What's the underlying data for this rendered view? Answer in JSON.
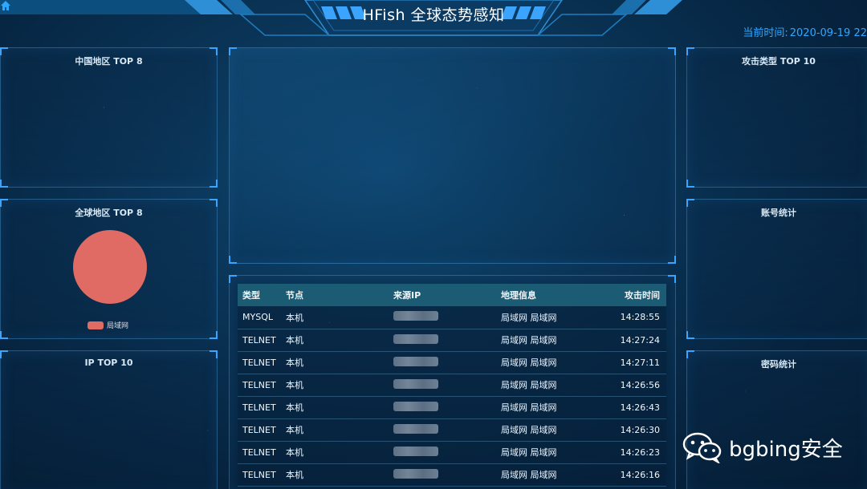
{
  "header": {
    "title": "HFish 全球态势感知",
    "current_time_label": "当前时间:",
    "current_time_value": "2020-09-19 22"
  },
  "panels": {
    "china_top": "中国地区 TOP 8",
    "global_top": "全球地区 TOP 8",
    "ip_top": "IP TOP 10",
    "attack_type_top": "攻击类型 TOP 10",
    "account_stats": "账号统计",
    "password_stats": "密码统计"
  },
  "global_chart": {
    "legend": "局域网",
    "color": "#e06b64"
  },
  "chart_data": {
    "type": "pie",
    "categories": [
      "局域网"
    ],
    "values": [
      100
    ],
    "title": "全球地区 TOP 8"
  },
  "table": {
    "headers": [
      "类型",
      "节点",
      "来源IP",
      "地理信息",
      "攻击时间"
    ],
    "rows": [
      {
        "type": "MYSQL",
        "node": "本机",
        "geo": "局域网 局域网",
        "time": "14:28:55"
      },
      {
        "type": "TELNET",
        "node": "本机",
        "geo": "局域网 局域网",
        "time": "14:27:24"
      },
      {
        "type": "TELNET",
        "node": "本机",
        "geo": "局域网 局域网",
        "time": "14:27:11"
      },
      {
        "type": "TELNET",
        "node": "本机",
        "geo": "局域网 局域网",
        "time": "14:26:56"
      },
      {
        "type": "TELNET",
        "node": "本机",
        "geo": "局域网 局域网",
        "time": "14:26:43"
      },
      {
        "type": "TELNET",
        "node": "本机",
        "geo": "局域网 局域网",
        "time": "14:26:30"
      },
      {
        "type": "TELNET",
        "node": "本机",
        "geo": "局域网 局域网",
        "time": "14:26:23"
      },
      {
        "type": "TELNET",
        "node": "本机",
        "geo": "局域网 局域网",
        "time": "14:26:16"
      }
    ]
  },
  "watermark": {
    "text": "bgbing安全",
    "icon": "wechat-icon"
  },
  "colors": {
    "accent": "#2ea8ff",
    "table_header_bg": "#1b5b73"
  }
}
